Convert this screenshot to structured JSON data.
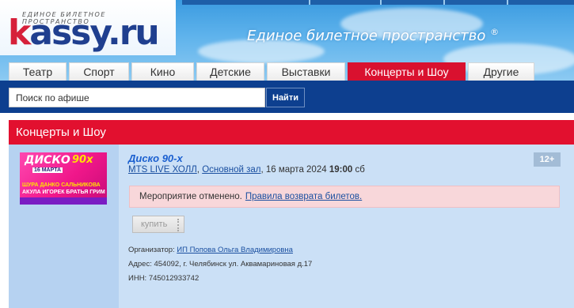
{
  "header": {
    "logo_tagline": "ЕДИНОЕ БИЛЕТНОЕ ПРОСТРАНСТВО",
    "logo_k": "k",
    "logo_rest": "assy.ru",
    "slogan": "Единое билетное пространство",
    "slogan_mark": "®"
  },
  "tabs": [
    {
      "label": "Театр"
    },
    {
      "label": "Спорт"
    },
    {
      "label": "Кино"
    },
    {
      "label": "Детские"
    },
    {
      "label": "Выставки"
    },
    {
      "label": "Концерты и Шоу",
      "active": true
    },
    {
      "label": "Другие"
    }
  ],
  "search": {
    "placeholder": "Поиск по афише",
    "button_label": "Найти"
  },
  "section": {
    "title": "Концерты и Шоу"
  },
  "event": {
    "poster": {
      "title": "ДИСКО",
      "title_suffix": "90х",
      "date": "16 МАРТА",
      "line1": "ШУРА ДАНКО САЛЬНИКОВА",
      "line2": "АКУЛА ИГОРЕК БРАТЬЯ ГРИМ"
    },
    "title": "Диско 90-х",
    "venue": "MTS LIVE ХОЛЛ",
    "hall": "Основной зал",
    "date": ", 16 марта 2024 ",
    "time": "19:00",
    "weekday": " сб",
    "age": "12+",
    "cancel_text": "Мероприятие отменено.",
    "refund_link": "Правила возврата билетов.",
    "buy_label": "купить",
    "organizer_label": "Организатор: ",
    "organizer_name": "ИП Попова Ольга Владимировна",
    "address": "Адрес: 454092, г. Челябинск ул. Аквамариновая д.17",
    "inn": "ИНН: 745012933742"
  }
}
